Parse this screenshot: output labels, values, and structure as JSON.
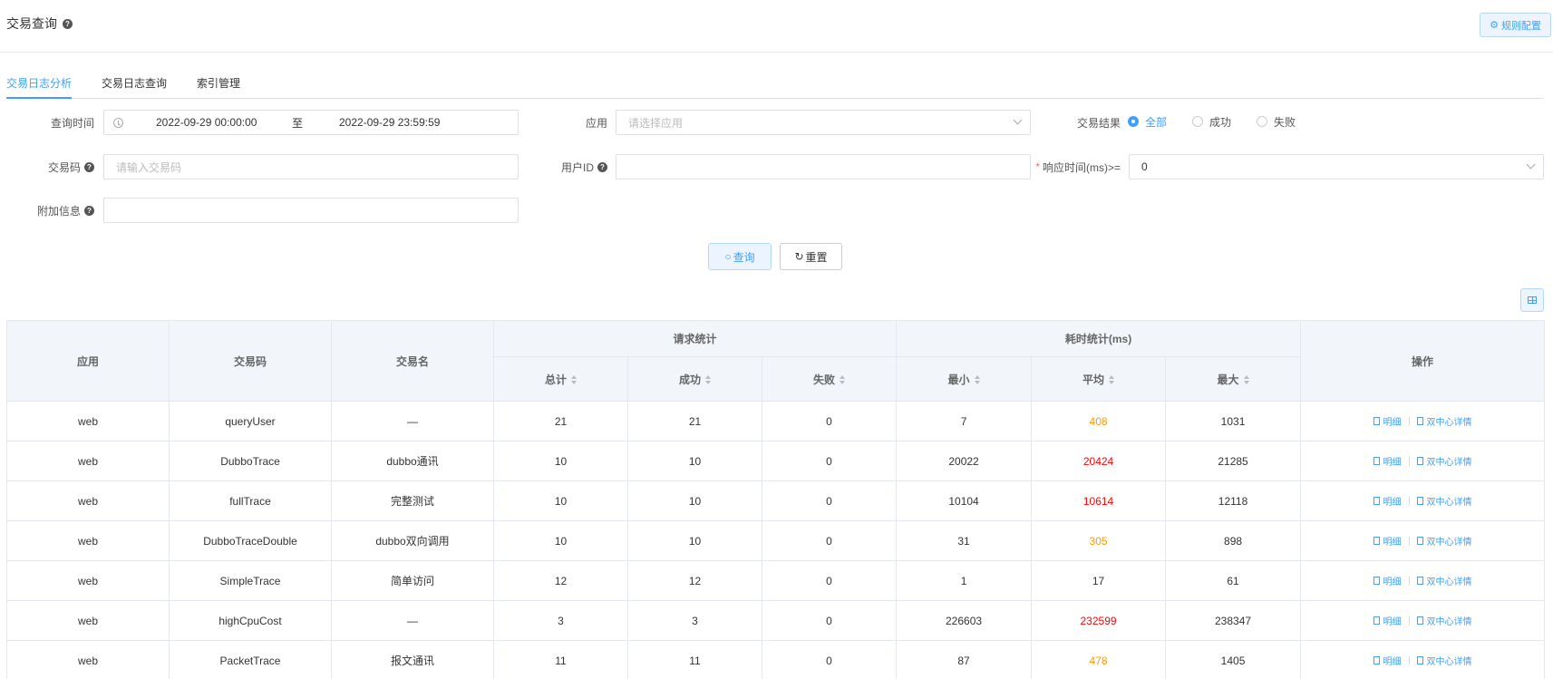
{
  "header": {
    "title": "交易查询",
    "rule_button": "规则配置"
  },
  "tabs": [
    {
      "label": "交易日志分析",
      "active": true
    },
    {
      "label": "交易日志查询",
      "active": false
    },
    {
      "label": "索引管理",
      "active": false
    }
  ],
  "form": {
    "query_time": {
      "label": "查询时间",
      "start": "2022-09-29 00:00:00",
      "separator": "至",
      "end": "2022-09-29 23:59:59"
    },
    "app": {
      "label": "应用",
      "placeholder": "请选择应用"
    },
    "result": {
      "label": "交易结果",
      "options": [
        "全部",
        "成功",
        "失败"
      ],
      "selected": "全部"
    },
    "trade_code": {
      "label": "交易码",
      "placeholder": "请输入交易码"
    },
    "user_id": {
      "label": "用户ID",
      "value": ""
    },
    "resp_time": {
      "label": "响应时间(ms)>=",
      "value": "0"
    },
    "extra": {
      "label": "附加信息",
      "value": ""
    }
  },
  "buttons": {
    "query": "查询",
    "reset": "重置"
  },
  "table": {
    "headers": {
      "app": "应用",
      "code": "交易码",
      "name": "交易名",
      "req_group": "请求统计",
      "total": "总计",
      "success": "成功",
      "fail": "失败",
      "time_group": "耗时统计(ms)",
      "min": "最小",
      "avg": "平均",
      "max": "最大",
      "ops": "操作"
    },
    "op_detail": "明细",
    "op_center": "双中心详情",
    "rows": [
      {
        "app": "web",
        "code": "queryUser",
        "name": "—",
        "total": "21",
        "success": "21",
        "fail": "0",
        "min": "7",
        "avg": "408",
        "avg_color": "orange",
        "max": "1031"
      },
      {
        "app": "web",
        "code": "DubboTrace",
        "name": "dubbo通讯",
        "total": "10",
        "success": "10",
        "fail": "0",
        "min": "20022",
        "avg": "20424",
        "avg_color": "red",
        "max": "21285"
      },
      {
        "app": "web",
        "code": "fullTrace",
        "name": "完整测试",
        "total": "10",
        "success": "10",
        "fail": "0",
        "min": "10104",
        "avg": "10614",
        "avg_color": "red",
        "max": "12118"
      },
      {
        "app": "web",
        "code": "DubboTraceDouble",
        "name": "dubbo双向调用",
        "total": "10",
        "success": "10",
        "fail": "0",
        "min": "31",
        "avg": "305",
        "avg_color": "orange",
        "max": "898"
      },
      {
        "app": "web",
        "code": "SimpleTrace",
        "name": "简单访问",
        "total": "12",
        "success": "12",
        "fail": "0",
        "min": "1",
        "avg": "17",
        "avg_color": "normal",
        "max": "61"
      },
      {
        "app": "web",
        "code": "highCpuCost",
        "name": "—",
        "total": "3",
        "success": "3",
        "fail": "0",
        "min": "226603",
        "avg": "232599",
        "avg_color": "red",
        "max": "238347"
      },
      {
        "app": "web",
        "code": "PacketTrace",
        "name": "报文通讯",
        "total": "11",
        "success": "11",
        "fail": "0",
        "min": "87",
        "avg": "478",
        "avg_color": "orange",
        "max": "1405"
      }
    ]
  }
}
